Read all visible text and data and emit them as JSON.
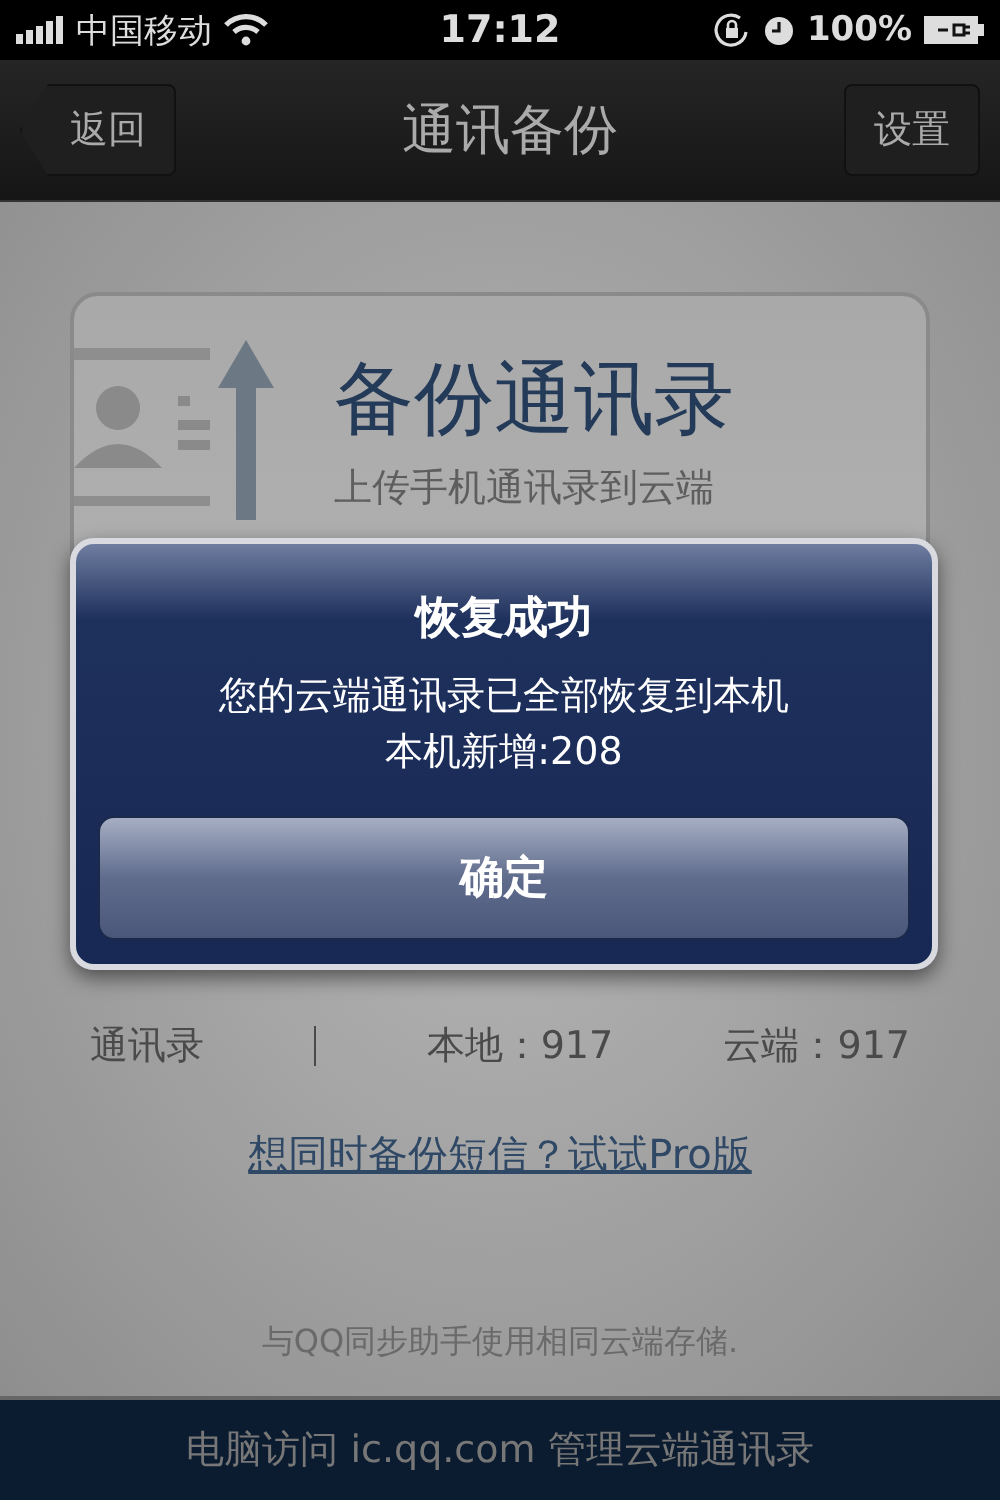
{
  "status_bar": {
    "carrier": "中国移动",
    "time": "17:12",
    "battery": "100%"
  },
  "nav": {
    "back": "返回",
    "title": "通讯备份",
    "settings": "设置"
  },
  "actions": [
    {
      "kind": "upload",
      "title": "备份通讯录",
      "subtitle": "上传手机通讯录到云端"
    }
  ],
  "stats": {
    "label": "通讯录",
    "local": "本地：917",
    "cloud": "云端：917"
  },
  "link": "想同时备份短信？试试Pro版",
  "note": "与QQ同步助手使用相同云端存储.",
  "footer": "电脑访问 ic.qq.com 管理云端通讯录",
  "alert": {
    "title": "恢复成功",
    "message": [
      "您的云端通讯录已全部恢复到本机",
      "本机新增:208"
    ],
    "button": "确定"
  }
}
